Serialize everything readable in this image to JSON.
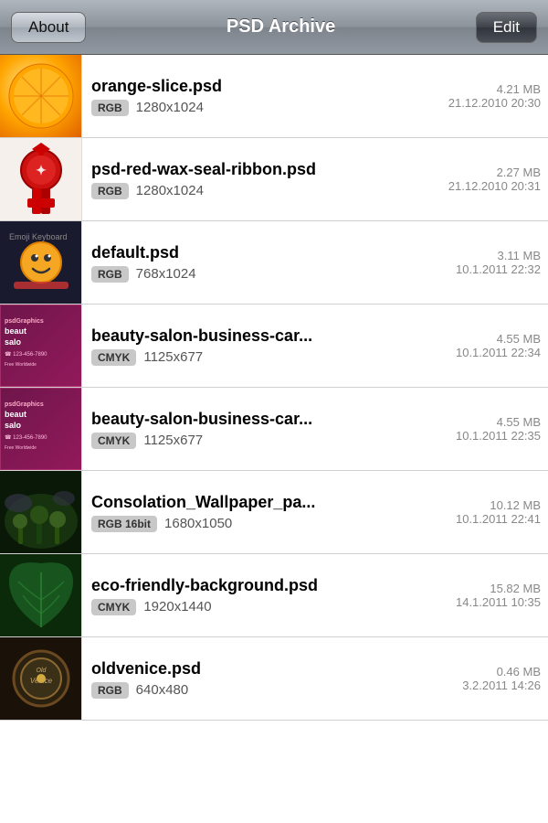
{
  "header": {
    "about_label": "About",
    "title": "PSD Archive",
    "edit_label": "Edit"
  },
  "items": [
    {
      "id": "item-0",
      "name": "orange-slice.psd",
      "colorMode": "RGB",
      "dimensions": "1280x1024",
      "size": "4.21 MB",
      "date": "21.12.2010 20:30",
      "thumb": "orange"
    },
    {
      "id": "item-1",
      "name": "psd-red-wax-seal-ribbon.psd",
      "colorMode": "RGB",
      "dimensions": "1280x1024",
      "size": "2.27 MB",
      "date": "21.12.2010 20:31",
      "thumb": "seal"
    },
    {
      "id": "item-2",
      "name": "default.psd",
      "colorMode": "RGB",
      "dimensions": "768x1024",
      "size": "3.11 MB",
      "date": "10.1.2011 22:32",
      "thumb": "emoji"
    },
    {
      "id": "item-3",
      "name": "beauty-salon-business-car...",
      "colorMode": "CMYK",
      "dimensions": "1125x677",
      "size": "4.55 MB",
      "date": "10.1.2011 22:34",
      "thumb": "beauty1"
    },
    {
      "id": "item-4",
      "name": "beauty-salon-business-car...",
      "colorMode": "CMYK",
      "dimensions": "1125x677",
      "size": "4.55 MB",
      "date": "10.1.2011 22:35",
      "thumb": "beauty2"
    },
    {
      "id": "item-5",
      "name": "Consolation_Wallpaper_pa...",
      "colorMode": "RGB 16bit",
      "dimensions": "1680x1050",
      "size": "10.12 MB",
      "date": "10.1.2011 22:41",
      "thumb": "consolation"
    },
    {
      "id": "item-6",
      "name": "eco-friendly-background.psd",
      "colorMode": "CMYK",
      "dimensions": "1920x1440",
      "size": "15.82 MB",
      "date": "14.1.2011 10:35",
      "thumb": "eco"
    },
    {
      "id": "item-7",
      "name": "oldvenice.psd",
      "colorMode": "RGB",
      "dimensions": "640x480",
      "size": "0.46 MB",
      "date": "3.2.2011 14:26",
      "thumb": "venice"
    }
  ],
  "thumbColors": {
    "orange": "#ffa500",
    "seal": "#8b0000",
    "emoji": "#1a1a2e",
    "beauty1": "#8b1a5a",
    "beauty2": "#8b1a5a",
    "consolation": "#1a3a10",
    "eco": "#1a5a20",
    "venice": "#3a3020"
  }
}
